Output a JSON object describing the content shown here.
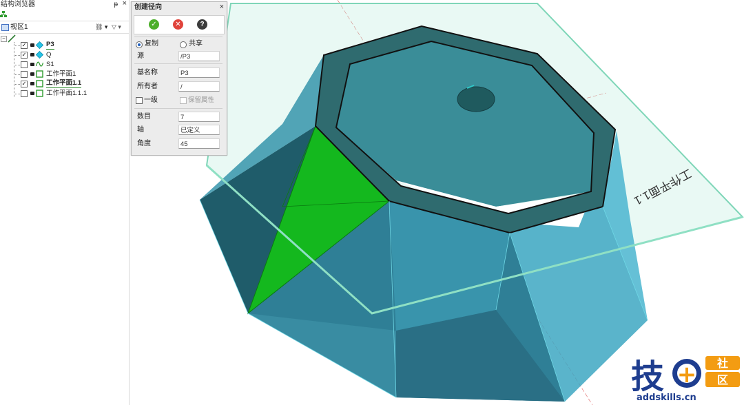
{
  "browser": {
    "title": "结构浏览器",
    "pin": "ᵽ",
    "close": "×",
    "view_label": "视区1",
    "tree": [
      {
        "label": "P3",
        "checked": true,
        "bold": true,
        "icon": "diamond-icon"
      },
      {
        "label": "Q",
        "checked": true,
        "bold": false,
        "icon": "diamond-icon"
      },
      {
        "label": "S1",
        "checked": false,
        "bold": false,
        "icon": "sketch-icon"
      },
      {
        "label": "工作平面1",
        "checked": false,
        "bold": false,
        "icon": "workplane-icon"
      },
      {
        "label": "工作平面1.1",
        "checked": true,
        "bold": true,
        "icon": "workplane-icon"
      },
      {
        "label": "工作平面1.1.1",
        "checked": false,
        "bold": false,
        "icon": "workplane-icon"
      }
    ]
  },
  "dialog": {
    "title": "创建径向",
    "close": "×",
    "ok": "✓",
    "cancel": "✕",
    "help": "?",
    "mode_copy": "复制",
    "mode_share": "共享",
    "source_label": "源",
    "source_value": "/P3",
    "basename_label": "基名称",
    "basename_value": "P3",
    "owner_label": "所有者",
    "owner_value": "/",
    "level_label": "一级",
    "keep_attr_label": "保留属性",
    "count_label": "数目",
    "count_value": "7",
    "axis_label": "轴",
    "axis_value": "已定义",
    "angle_label": "角度",
    "angle_value": "45"
  },
  "viewport": {
    "workplane_label": "工作平面1.1",
    "colors": {
      "solid": "#2e8f9c",
      "highlight": "#14b81e",
      "rim": "#2f6b6f",
      "plane": "#8fd9c4"
    }
  },
  "watermark": {
    "char_big": "技",
    "char_plus": "+",
    "char_small_1": "社",
    "char_small_2": "区",
    "url": "addskills.cn"
  }
}
